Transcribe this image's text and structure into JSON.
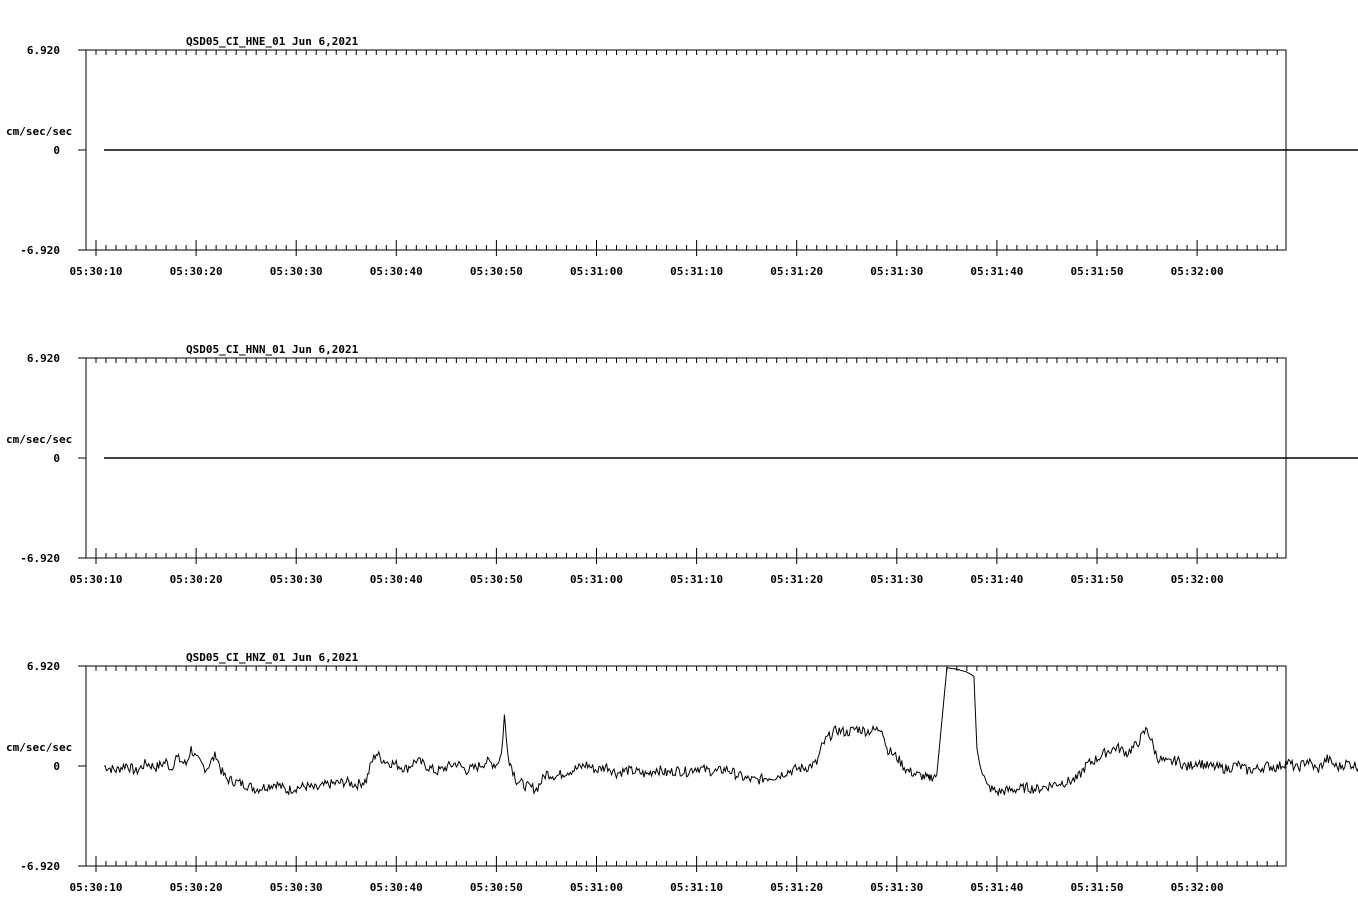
{
  "chart_data": [
    {
      "type": "line",
      "title": "QSD05_CI_HNE_01  Jun 6,2021",
      "ylabel": "cm/sec/sec",
      "ylim": [
        -6.92,
        6.92
      ],
      "ytick_labels": [
        "6.920",
        "0",
        "-6.920"
      ],
      "xtick_labels": [
        "05:30:10",
        "05:30:20",
        "05:30:30",
        "05:30:40",
        "05:30:50",
        "05:31:00",
        "05:31:10",
        "05:31:20",
        "05:31:30",
        "05:31:40",
        "05:31:50",
        "05:32:00"
      ],
      "x_start_s": 10.8,
      "x_end_s": 138.9,
      "xlim_s": [
        9,
        139
      ],
      "grid": false,
      "trace_points_s": [
        10.8,
        138.9
      ],
      "trace_values": [
        0,
        0
      ]
    },
    {
      "type": "line",
      "title": "QSD05_CI_HNN_01  Jun 6,2021",
      "ylabel": "cm/sec/sec",
      "ylim": [
        -6.92,
        6.92
      ],
      "ytick_labels": [
        "6.920",
        "0",
        "-6.920"
      ],
      "xtick_labels": [
        "05:30:10",
        "05:30:20",
        "05:30:30",
        "05:30:40",
        "05:30:50",
        "05:31:00",
        "05:31:10",
        "05:31:20",
        "05:31:30",
        "05:31:40",
        "05:31:50",
        "05:32:00"
      ],
      "xlim_s": [
        9,
        139
      ],
      "grid": false,
      "trace_points_s": [
        10.8,
        138.9
      ],
      "trace_values": [
        0,
        0
      ]
    },
    {
      "type": "line",
      "title": "QSD05_CI_HNZ_01  Jun 6,2021",
      "ylabel": "cm/sec/sec",
      "ylim": [
        -6.92,
        6.92
      ],
      "ytick_labels": [
        "6.920",
        "0",
        "-6.920"
      ],
      "xtick_labels": [
        "05:30:10",
        "05:30:20",
        "05:30:30",
        "05:30:40",
        "05:30:50",
        "05:31:00",
        "05:31:10",
        "05:31:20",
        "05:31:30",
        "05:31:40",
        "05:31:50",
        "05:32:00"
      ],
      "xlim_s": [
        9,
        139
      ],
      "grid": false,
      "trace_points_s": [
        10.8,
        12,
        13,
        14,
        15,
        16,
        17,
        17.5,
        18,
        19,
        19.5,
        20,
        21,
        22,
        22.5,
        23,
        24,
        25,
        26,
        27,
        28,
        29,
        30,
        31,
        32,
        33,
        34,
        35,
        36,
        37,
        37.5,
        38,
        38.5,
        39,
        40,
        41,
        42,
        43,
        44,
        45,
        46,
        47,
        48,
        49,
        50,
        50.5,
        50.8,
        51,
        51.3,
        52,
        53,
        54,
        55,
        56,
        57,
        58,
        59,
        60,
        61,
        62,
        63,
        64,
        65,
        66,
        67,
        68,
        69,
        70,
        71,
        72,
        73,
        74,
        75,
        76,
        77,
        78,
        79,
        80,
        81,
        82,
        82.5,
        83,
        84,
        85,
        86,
        87,
        88,
        88.5,
        89,
        90,
        91,
        92,
        93,
        93.2,
        93.3,
        94,
        95,
        96,
        97,
        97.5,
        97.7,
        98,
        99,
        100,
        101,
        102,
        103,
        104,
        105,
        106,
        107,
        108,
        109,
        110,
        111,
        112,
        113,
        114,
        115,
        116,
        117,
        118,
        119,
        120,
        121,
        122,
        123,
        124,
        125,
        126,
        127,
        128,
        129,
        130,
        131,
        132,
        133,
        134,
        135,
        136,
        137,
        138,
        138.9
      ],
      "trace_values": [
        0,
        -0.3,
        0.1,
        -0.4,
        0.2,
        -0.1,
        0.3,
        -0.2,
        0.6,
        0.1,
        1.2,
        0.5,
        -0.2,
        0.8,
        -0.3,
        -0.9,
        -1.1,
        -1.3,
        -1.6,
        -1.4,
        -1.2,
        -1.7,
        -1.5,
        -1.4,
        -1.6,
        -1.3,
        -1.2,
        -1.1,
        -1.3,
        -1.0,
        0.2,
        0.9,
        0.5,
        0.3,
        0.1,
        -0.2,
        0.4,
        0.0,
        -0.4,
        -0.1,
        0.2,
        -0.3,
        -0.1,
        0.3,
        0.1,
        0.8,
        3.5,
        1.8,
        0.4,
        -1.0,
        -1.4,
        -1.6,
        -0.5,
        -0.7,
        -0.4,
        -0.2,
        0.1,
        -0.3,
        0.0,
        -0.5,
        -0.3,
        -0.4,
        -0.6,
        -0.2,
        -0.5,
        -0.3,
        -0.4,
        -0.1,
        -0.3,
        -0.4,
        -0.2,
        -0.6,
        -0.9,
        -1.0,
        -0.8,
        -0.7,
        -0.4,
        -0.2,
        -0.1,
        0.2,
        1.3,
        1.9,
        2.5,
        2.3,
        2.6,
        2.4,
        2.5,
        2.7,
        1.2,
        0.6,
        -0.3,
        -0.6,
        -0.8,
        -1.0,
        -0.8,
        -0.6,
        6.8,
        6.7,
        6.5,
        6.3,
        6.2,
        1.0,
        -1.4,
        -1.8,
        -1.7,
        -1.6,
        -1.5,
        -1.6,
        -1.4,
        -1.2,
        -1.1,
        -0.9,
        0.1,
        0.5,
        1.0,
        1.3,
        0.9,
        1.5,
        2.6,
        0.6,
        0.2,
        0.4,
        -0.1,
        0.3,
        0.0,
        -0.1,
        -0.2,
        0.1,
        -0.3,
        -0.2,
        0.0,
        -0.1,
        0.3,
        -0.2,
        0.4,
        -0.3,
        0.5,
        -0.1,
        0.2,
        0.0,
        -0.1,
        -0.4,
        -1.2
      ]
    }
  ]
}
